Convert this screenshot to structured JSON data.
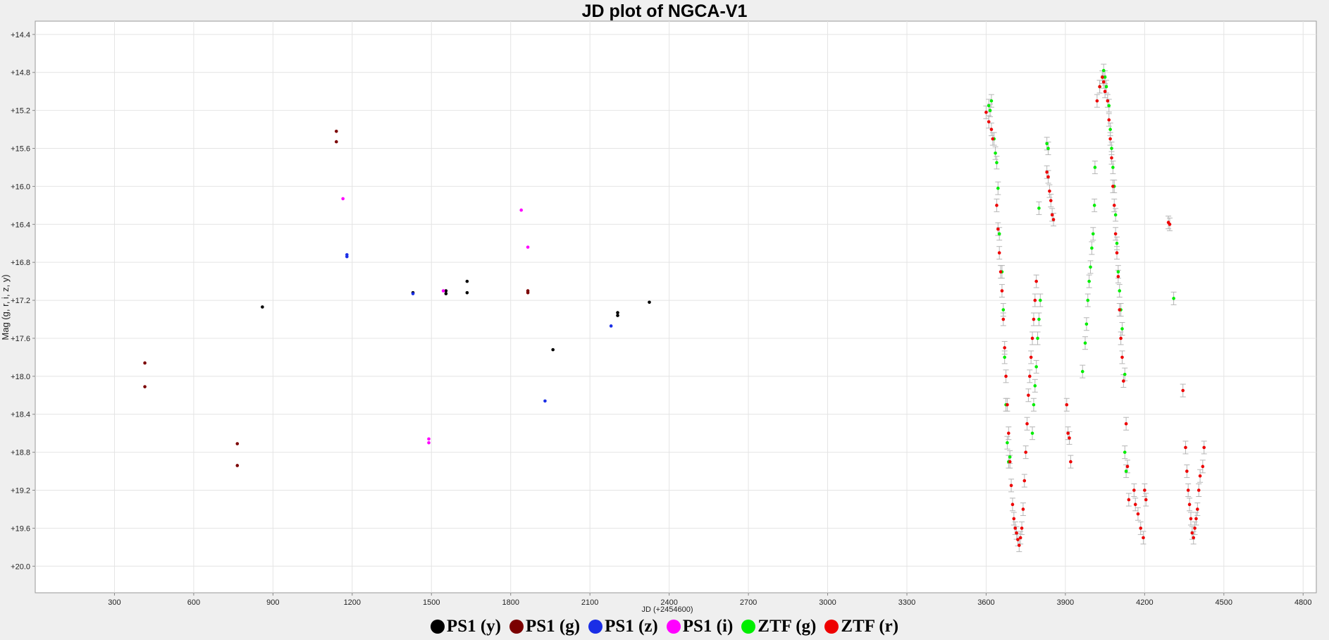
{
  "chart_data": {
    "type": "scatter",
    "title": "JD plot of NGCA-V1",
    "xlabel": "JD (+2454600)",
    "ylabel": "Mag (g, r, i, z, y)",
    "xlim": [
      0,
      4850
    ],
    "ylim": [
      20.28,
      14.26
    ],
    "y_inverted": true,
    "xticks": [
      300,
      600,
      900,
      1200,
      1500,
      1800,
      2100,
      2400,
      2700,
      3000,
      3300,
      3600,
      3900,
      4200,
      4500,
      4800
    ],
    "yticks": [
      14.4,
      14.8,
      15.2,
      15.6,
      16.0,
      16.4,
      16.8,
      17.2,
      17.6,
      18.0,
      18.4,
      18.8,
      19.2,
      19.6,
      20.0
    ],
    "ytick_labels": [
      "+14.4",
      "+14.8",
      "+15.2",
      "+15.6",
      "+16.0",
      "+16.4",
      "+16.8",
      "+17.2",
      "+17.6",
      "+18.0",
      "+18.4",
      "+18.8",
      "+19.2",
      "+19.6",
      "+20.0"
    ],
    "grid": true,
    "legend_position": "bottom",
    "series": [
      {
        "name": "PS1 (y)",
        "color": "#000000",
        "error_bars": false,
        "points": [
          [
            860,
            17.27
          ],
          [
            1430,
            17.12
          ],
          [
            1555,
            17.1
          ],
          [
            1555,
            17.13
          ],
          [
            1635,
            17.0
          ],
          [
            1635,
            17.12
          ],
          [
            1960,
            17.72
          ],
          [
            2205,
            17.33
          ],
          [
            2205,
            17.36
          ],
          [
            2325,
            17.22
          ]
        ]
      },
      {
        "name": "PS1 (g)",
        "color": "#7b0000",
        "error_bars": false,
        "points": [
          [
            415,
            17.86
          ],
          [
            415,
            18.11
          ],
          [
            765,
            18.71
          ],
          [
            765,
            18.94
          ],
          [
            1140,
            15.42
          ],
          [
            1140,
            15.53
          ],
          [
            1865,
            17.1
          ],
          [
            1865,
            17.12
          ]
        ]
      },
      {
        "name": "PS1 (z)",
        "color": "#1a2ee6",
        "error_bars": false,
        "points": [
          [
            1180,
            16.72
          ],
          [
            1180,
            16.74
          ],
          [
            1430,
            17.13
          ],
          [
            1930,
            18.26
          ],
          [
            2180,
            17.47
          ]
        ]
      },
      {
        "name": "PS1 (i)",
        "color": "#ff00ff",
        "error_bars": false,
        "points": [
          [
            1165,
            16.13
          ],
          [
            1490,
            18.66
          ],
          [
            1490,
            18.7
          ],
          [
            1545,
            17.1
          ],
          [
            1840,
            16.25
          ],
          [
            1865,
            16.64
          ]
        ]
      },
      {
        "name": "ZTF (g)",
        "color": "#00ee00",
        "error_bars": true,
        "points": [
          [
            3610,
            15.15
          ],
          [
            3615,
            15.2
          ],
          [
            3620,
            15.1
          ],
          [
            3630,
            15.5
          ],
          [
            3635,
            15.65
          ],
          [
            3640,
            15.75
          ],
          [
            3645,
            16.02
          ],
          [
            3650,
            16.5
          ],
          [
            3660,
            16.9
          ],
          [
            3665,
            17.3
          ],
          [
            3670,
            17.8
          ],
          [
            3675,
            18.3
          ],
          [
            3680,
            18.7
          ],
          [
            3685,
            18.9
          ],
          [
            3690,
            18.85
          ],
          [
            3775,
            18.6
          ],
          [
            3780,
            18.3
          ],
          [
            3785,
            18.1
          ],
          [
            3790,
            17.9
          ],
          [
            3795,
            17.6
          ],
          [
            3800,
            17.4
          ],
          [
            3805,
            17.2
          ],
          [
            3800,
            16.23
          ],
          [
            3830,
            15.55
          ],
          [
            3835,
            15.6
          ],
          [
            3965,
            17.95
          ],
          [
            3975,
            17.65
          ],
          [
            3980,
            17.45
          ],
          [
            3985,
            17.2
          ],
          [
            3990,
            17.0
          ],
          [
            3995,
            16.85
          ],
          [
            4000,
            16.65
          ],
          [
            4005,
            16.5
          ],
          [
            4010,
            16.2
          ],
          [
            4012,
            15.8
          ],
          [
            4030,
            14.95
          ],
          [
            4040,
            14.85
          ],
          [
            4045,
            14.78
          ],
          [
            4050,
            14.85
          ],
          [
            4055,
            14.95
          ],
          [
            4065,
            15.15
          ],
          [
            4070,
            15.4
          ],
          [
            4075,
            15.6
          ],
          [
            4080,
            15.8
          ],
          [
            4085,
            16.0
          ],
          [
            4090,
            16.3
          ],
          [
            4095,
            16.6
          ],
          [
            4100,
            16.9
          ],
          [
            4105,
            17.1
          ],
          [
            4110,
            17.3
          ],
          [
            4115,
            17.5
          ],
          [
            4125,
            17.98
          ],
          [
            4125,
            18.8
          ],
          [
            4130,
            19.0
          ],
          [
            4310,
            17.18
          ]
        ]
      },
      {
        "name": "ZTF (r)",
        "color": "#ee0000",
        "error_bars": true,
        "points": [
          [
            3600,
            15.22
          ],
          [
            3610,
            15.32
          ],
          [
            3620,
            15.4
          ],
          [
            3625,
            15.5
          ],
          [
            3640,
            16.2
          ],
          [
            3645,
            16.45
          ],
          [
            3650,
            16.7
          ],
          [
            3655,
            16.9
          ],
          [
            3660,
            17.1
          ],
          [
            3665,
            17.4
          ],
          [
            3670,
            17.7
          ],
          [
            3675,
            18.0
          ],
          [
            3680,
            18.3
          ],
          [
            3685,
            18.6
          ],
          [
            3690,
            18.9
          ],
          [
            3695,
            19.15
          ],
          [
            3700,
            19.35
          ],
          [
            3705,
            19.5
          ],
          [
            3710,
            19.6
          ],
          [
            3715,
            19.65
          ],
          [
            3720,
            19.72
          ],
          [
            3725,
            19.78
          ],
          [
            3730,
            19.7
          ],
          [
            3735,
            19.6
          ],
          [
            3740,
            19.4
          ],
          [
            3745,
            19.1
          ],
          [
            3750,
            18.8
          ],
          [
            3755,
            18.5
          ],
          [
            3760,
            18.2
          ],
          [
            3765,
            18.0
          ],
          [
            3770,
            17.8
          ],
          [
            3775,
            17.6
          ],
          [
            3780,
            17.4
          ],
          [
            3785,
            17.2
          ],
          [
            3790,
            17.0
          ],
          [
            3830,
            15.85
          ],
          [
            3835,
            15.9
          ],
          [
            3840,
            16.05
          ],
          [
            3845,
            16.15
          ],
          [
            3850,
            16.3
          ],
          [
            3855,
            16.35
          ],
          [
            3905,
            18.3
          ],
          [
            3910,
            18.6
          ],
          [
            3915,
            18.65
          ],
          [
            3920,
            18.9
          ],
          [
            4020,
            15.1
          ],
          [
            4030,
            14.95
          ],
          [
            4040,
            14.85
          ],
          [
            4045,
            14.9
          ],
          [
            4050,
            15.0
          ],
          [
            4060,
            15.1
          ],
          [
            4065,
            15.3
          ],
          [
            4070,
            15.5
          ],
          [
            4075,
            15.7
          ],
          [
            4080,
            16.0
          ],
          [
            4085,
            16.2
          ],
          [
            4090,
            16.5
          ],
          [
            4095,
            16.7
          ],
          [
            4100,
            16.95
          ],
          [
            4105,
            17.3
          ],
          [
            4110,
            17.6
          ],
          [
            4115,
            17.8
          ],
          [
            4120,
            18.05
          ],
          [
            4130,
            18.5
          ],
          [
            4135,
            18.95
          ],
          [
            4140,
            19.3
          ],
          [
            4160,
            19.2
          ],
          [
            4165,
            19.35
          ],
          [
            4175,
            19.45
          ],
          [
            4185,
            19.6
          ],
          [
            4195,
            19.7
          ],
          [
            4200,
            19.2
          ],
          [
            4205,
            19.3
          ],
          [
            4290,
            16.38
          ],
          [
            4295,
            16.4
          ],
          [
            4345,
            18.15
          ],
          [
            4355,
            18.75
          ],
          [
            4360,
            19.0
          ],
          [
            4365,
            19.2
          ],
          [
            4370,
            19.35
          ],
          [
            4375,
            19.5
          ],
          [
            4380,
            19.65
          ],
          [
            4385,
            19.7
          ],
          [
            4390,
            19.6
          ],
          [
            4395,
            19.5
          ],
          [
            4400,
            19.4
          ],
          [
            4405,
            19.2
          ],
          [
            4410,
            19.05
          ],
          [
            4420,
            18.95
          ],
          [
            4425,
            18.75
          ]
        ]
      }
    ]
  },
  "legend": [
    {
      "label": "PS1 (y)",
      "color": "#000000"
    },
    {
      "label": "PS1 (g)",
      "color": "#7b0000"
    },
    {
      "label": "PS1 (z)",
      "color": "#1a2ee6"
    },
    {
      "label": "PS1 (i)",
      "color": "#ff00ff"
    },
    {
      "label": "ZTF (g)",
      "color": "#00ee00"
    },
    {
      "label": "ZTF (r)",
      "color": "#ee0000"
    }
  ]
}
